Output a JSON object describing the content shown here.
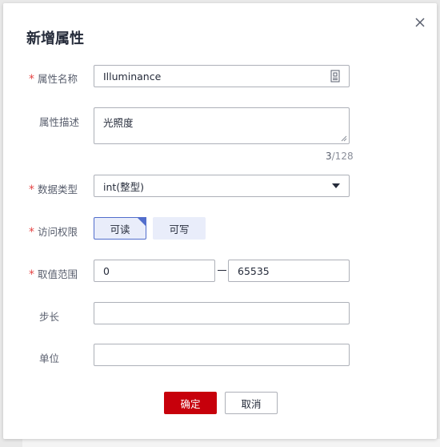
{
  "dialog": {
    "title": "新增属性",
    "close_icon": "close-icon"
  },
  "form": {
    "name": {
      "label": "属性名称",
      "required": true,
      "value": "Illuminance",
      "icon": "id-card-icon"
    },
    "description": {
      "label": "属性描述",
      "required": false,
      "value": "光照度",
      "count_current": "3",
      "count_max": "/128"
    },
    "data_type": {
      "label": "数据类型",
      "required": true,
      "value": "int(整型)",
      "icon": "caret-down-icon"
    },
    "access": {
      "label": "访问权限",
      "required": true,
      "options": [
        {
          "label": "可读",
          "selected": true
        },
        {
          "label": "可写",
          "selected": false
        }
      ]
    },
    "range": {
      "label": "取值范围",
      "required": true,
      "min": "0",
      "max": "65535"
    },
    "step": {
      "label": "步长",
      "required": false,
      "value": ""
    },
    "unit": {
      "label": "单位",
      "required": false,
      "value": ""
    }
  },
  "footer": {
    "confirm_label": "确定",
    "cancel_label": "取消"
  },
  "colors": {
    "required_star": "#e54545",
    "primary_button": "#c7000b",
    "selected_border": "#526ecc",
    "toggle_background": "#e9edfa"
  }
}
